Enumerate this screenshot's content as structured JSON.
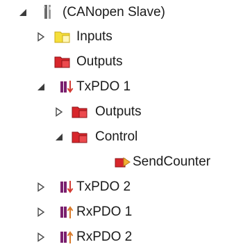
{
  "tree": {
    "nodes": [
      {
        "label": "(CANopen Slave)",
        "icon": "device-icon",
        "state": "expanded"
      },
      {
        "label": "Inputs",
        "icon": "inputs-folder-icon",
        "state": "collapsed"
      },
      {
        "label": "Outputs",
        "icon": "outputs-folder-icon",
        "state": "none"
      },
      {
        "label": "TxPDO 1",
        "icon": "txpdo-icon",
        "state": "expanded"
      },
      {
        "label": "Outputs",
        "icon": "outputs-folder-icon",
        "state": "collapsed"
      },
      {
        "label": "Control",
        "icon": "outputs-folder-icon",
        "state": "expanded"
      },
      {
        "label": "SendCounter",
        "icon": "output-variable-icon",
        "state": "none"
      },
      {
        "label": "TxPDO 2",
        "icon": "txpdo-icon",
        "state": "collapsed"
      },
      {
        "label": "RxPDO 1",
        "icon": "rxpdo-icon",
        "state": "collapsed"
      },
      {
        "label": "RxPDO 2",
        "icon": "rxpdo-icon",
        "state": "collapsed"
      }
    ]
  },
  "colors": {
    "expanded_arrow": "#3c3c3c",
    "collapsed_arrow": "#4a4a4a",
    "outputs_red": "#d8262b",
    "outputs_dark": "#8b1418",
    "inputs_yellow": "#f5df3a",
    "pdo_purple": "#7a1f6e",
    "tx_arrow": "#d33a32",
    "rx_arrow": "#d87a2a"
  }
}
